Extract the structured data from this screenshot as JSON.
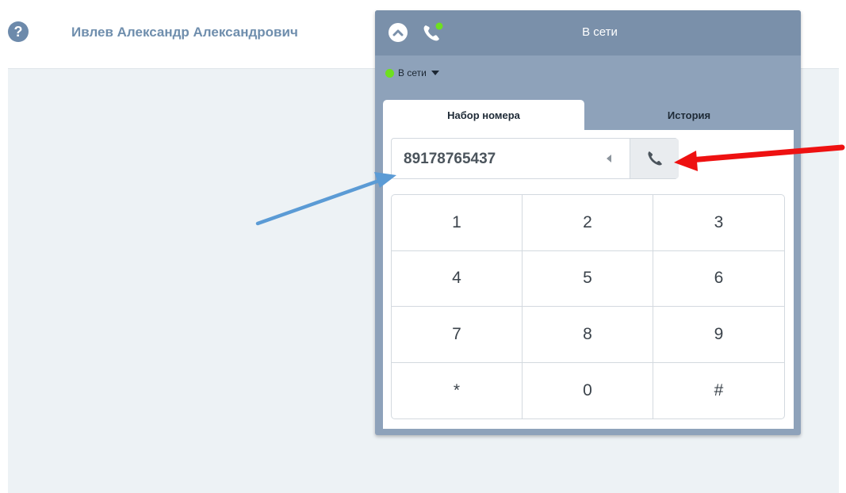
{
  "header": {
    "help_icon": "question-icon",
    "help_glyph": "?",
    "user_name": "Ивлев Александр Александрович"
  },
  "widget": {
    "header_status": "В сети",
    "status_label": "В сети",
    "status_color": "#6ee01f",
    "tabs": [
      {
        "label": "Набор номера",
        "active": true
      },
      {
        "label": "История",
        "active": false
      }
    ],
    "number_value": "89178765437",
    "keypad": [
      "1",
      "2",
      "3",
      "4",
      "5",
      "6",
      "7",
      "8",
      "9",
      "*",
      "0",
      "#"
    ]
  },
  "colors": {
    "widget_header": "#7a90aa",
    "widget_body": "#8ea2ba",
    "accent_user": "#6f8ead",
    "arrow_red": "#ee1111",
    "arrow_blue": "#5b9bd5"
  }
}
